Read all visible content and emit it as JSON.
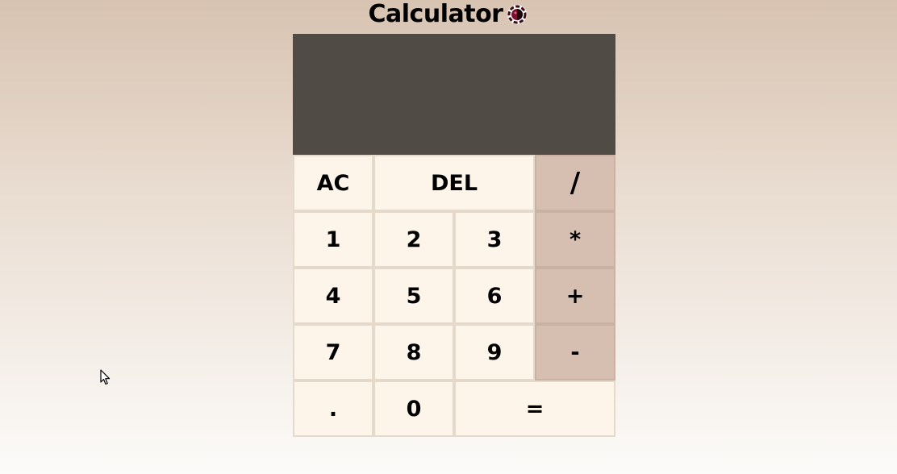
{
  "header": {
    "title": "Calculator",
    "logo_icon": "calculator-logo-icon"
  },
  "display": {
    "previous_operand": "",
    "current_operand": ""
  },
  "keys": {
    "row1": [
      {
        "label": "AC",
        "name": "all-clear-button",
        "operator": false,
        "span": 1
      },
      {
        "label": "DEL",
        "name": "delete-button",
        "operator": false,
        "span": 2
      },
      {
        "label": "/",
        "name": "divide-button",
        "operator": true,
        "span": 1
      }
    ],
    "row2": [
      {
        "label": "1",
        "name": "digit-1-button",
        "operator": false,
        "span": 1
      },
      {
        "label": "2",
        "name": "digit-2-button",
        "operator": false,
        "span": 1
      },
      {
        "label": "3",
        "name": "digit-3-button",
        "operator": false,
        "span": 1
      },
      {
        "label": "*",
        "name": "multiply-button",
        "operator": true,
        "span": 1
      }
    ],
    "row3": [
      {
        "label": "4",
        "name": "digit-4-button",
        "operator": false,
        "span": 1
      },
      {
        "label": "5",
        "name": "digit-5-button",
        "operator": false,
        "span": 1
      },
      {
        "label": "6",
        "name": "digit-6-button",
        "operator": false,
        "span": 1
      },
      {
        "label": "+",
        "name": "add-button",
        "operator": true,
        "span": 1
      }
    ],
    "row4": [
      {
        "label": "7",
        "name": "digit-7-button",
        "operator": false,
        "span": 1
      },
      {
        "label": "8",
        "name": "digit-8-button",
        "operator": false,
        "span": 1
      },
      {
        "label": "9",
        "name": "digit-9-button",
        "operator": false,
        "span": 1
      },
      {
        "label": "-",
        "name": "subtract-button",
        "operator": true,
        "span": 1
      }
    ],
    "row5": [
      {
        "label": ".",
        "name": "decimal-button",
        "operator": false,
        "span": 1
      },
      {
        "label": "0",
        "name": "digit-0-button",
        "operator": false,
        "span": 1
      },
      {
        "label": "=",
        "name": "equals-button",
        "operator": false,
        "span": 2
      }
    ]
  },
  "colors": {
    "display_bg": "#514b45",
    "key_bg": "#fdf4ea",
    "operator_bg": "#d6bfb0",
    "logo_accent": "#7a0f2e"
  }
}
